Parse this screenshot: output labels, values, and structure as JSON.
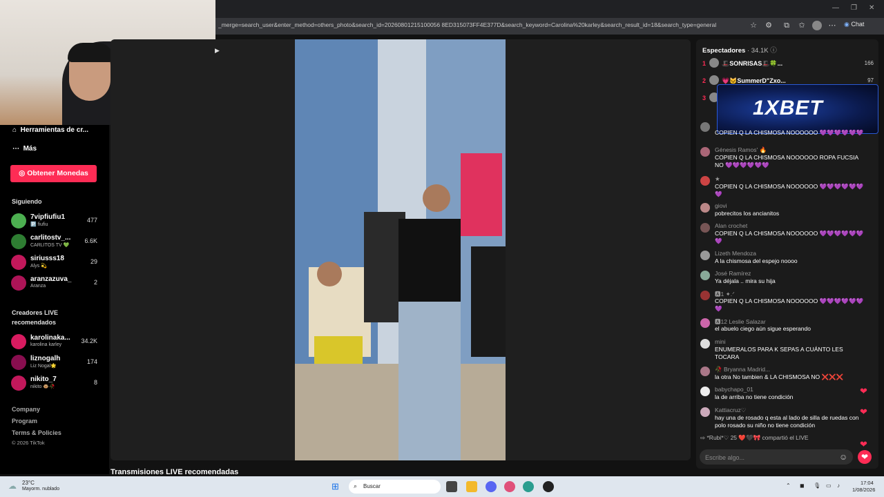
{
  "browser": {
    "url": "_merge=search_user&enter_method=others_photo&search_id=20260801215100056 8ED315073FF4E377D&search_keyword=Carolina%20karley&search_result_id=18&search_type=general",
    "chat_label": "Chat"
  },
  "sidebar": {
    "nav": [
      {
        "icon": "home-icon",
        "label": "Herramientas de cr..."
      },
      {
        "icon": "more-icon",
        "label": "Más"
      }
    ],
    "coins_button": "Obtener Monedas",
    "following_title": "Siguiendo",
    "following": [
      {
        "name": "7vipfiufiu1",
        "sub": "🅿️ fiufiu",
        "count": "477",
        "color": "#4caf50"
      },
      {
        "name": "carlitostv_...",
        "sub": "CARLITOS TV 💚",
        "count": "6.6K",
        "color": "#2e7d32"
      },
      {
        "name": "siriusss18",
        "sub": "Alys 💫",
        "count": "29",
        "color": "#c2185b"
      },
      {
        "name": "aranzazuva_",
        "sub": "Aranza",
        "count": "2",
        "color": "#ad1457"
      }
    ],
    "recommended_title": "Creadores LIVE recomendados",
    "recommended": [
      {
        "name": "karolinaka...",
        "sub": "karolina karley",
        "count": "34.2K",
        "color": "#d81b60"
      },
      {
        "name": "liznogalh",
        "sub": "Liz Nogal🌟",
        "count": "174",
        "color": "#880e4f"
      },
      {
        "name": "nikito_7",
        "sub": "nikito 🐵🥀",
        "count": "8",
        "color": "#c2185b"
      }
    ],
    "footer": [
      "Company",
      "Program",
      "Terms & Policies",
      "© 2026 TikTok"
    ]
  },
  "main": {
    "section_title": "Transmisiones LIVE recomendadas"
  },
  "chat": {
    "viewers_label": "Espectadores",
    "viewers_count": "· 34.1K",
    "ranking": [
      {
        "rank": "1",
        "name": "🎩SONRISAS🎩🍀...",
        "score": "166"
      },
      {
        "name": "💗🐱SummerD\"Zxo...",
        "rank": "2",
        "score": "97"
      },
      {
        "rank": "3",
        "name": "",
        "score": ""
      }
    ],
    "ad_text": "1XBET",
    "messages": [
      {
        "user": "",
        "text": "COPIEN Q LA CHISMOSA NOOOOOO 💜💜💜💜💜💜",
        "av": "#777",
        "heart": false
      },
      {
        "user": "Génesis Ramos' 🔥",
        "text": "COPIEN Q LA CHISMOSA NOOOOOO ROPA FUCSIA NO 💜💜💜💜💜💜",
        "av": "#a67",
        "heart": false
      },
      {
        "user": "★",
        "text": "COPIEN Q LA CHISMOSA NOOOOOO 💜💜💜💜💜💜💜",
        "av": "#c44",
        "heart": false
      },
      {
        "user": "giovi",
        "text": "pobrecitos los ancianitos",
        "av": "#b88",
        "heart": false
      },
      {
        "user": "Alan crochet",
        "text": "COPIEN Q LA CHISMOSA NOOOOOO 💜💜💜💜💜💜💜",
        "av": "#755",
        "heart": false
      },
      {
        "user": "Lizeth Mendoza",
        "text": "A la chismosa del espejo noooo",
        "av": "#999",
        "heart": false
      },
      {
        "user": "José Ramírez",
        "text": "Ya déjala .. mira su hija",
        "av": "#8a9",
        "heart": false
      },
      {
        "user": "🅰1 ✦.ᐟ",
        "text": "COPIEN Q LA CHISMOSA NOOOOOO 💜💜💜💜💜💜💜",
        "av": "#933",
        "heart": false
      },
      {
        "user": "🅰12 Leslie Salazar",
        "text": "el abuelo ciego aún sigue esperando",
        "av": "#c6a",
        "heart": false
      },
      {
        "user": "mini",
        "text": "ENUMERALOS PARA K SEPAS A CUÁNTO LES TOCARA",
        "av": "#ddd",
        "heart": false
      },
      {
        "user": "🥀 Bryanna Madrid...",
        "text": "la otra No tambien & LA CHISMOSA NO ❌❌❌",
        "av": "#a78",
        "heart": false
      },
      {
        "user": "babychapo_01",
        "text": "la de arriba no tiene condición",
        "av": "#eee",
        "heart": true
      },
      {
        "user": "Kattiacruz♡",
        "text": "hay una de rosado q esta al lado de silla de ruedas con polo rosado su niño no tiene condición",
        "av": "#cab",
        "heart": true
      }
    ],
    "share_line": "*Rubi*♡ 25 ❤️🖤🎀  compartió el LIVE",
    "input_placeholder": "Escribe algo..."
  },
  "taskbar": {
    "weather_temp": "23°C",
    "weather_desc": "Mayorm. nublado",
    "search_placeholder": "Buscar",
    "time": "17:04",
    "date": "1/08/2026"
  }
}
